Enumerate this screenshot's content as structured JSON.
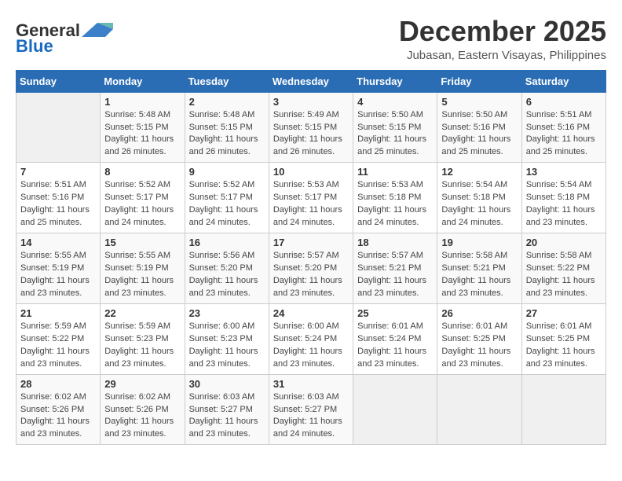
{
  "header": {
    "logo_general": "General",
    "logo_blue": "Blue",
    "month": "December 2025",
    "location": "Jubasan, Eastern Visayas, Philippines"
  },
  "days_of_week": [
    "Sunday",
    "Monday",
    "Tuesday",
    "Wednesday",
    "Thursday",
    "Friday",
    "Saturday"
  ],
  "weeks": [
    [
      {
        "day": "",
        "info": ""
      },
      {
        "day": "1",
        "info": "Sunrise: 5:48 AM\nSunset: 5:15 PM\nDaylight: 11 hours\nand 26 minutes."
      },
      {
        "day": "2",
        "info": "Sunrise: 5:48 AM\nSunset: 5:15 PM\nDaylight: 11 hours\nand 26 minutes."
      },
      {
        "day": "3",
        "info": "Sunrise: 5:49 AM\nSunset: 5:15 PM\nDaylight: 11 hours\nand 26 minutes."
      },
      {
        "day": "4",
        "info": "Sunrise: 5:50 AM\nSunset: 5:15 PM\nDaylight: 11 hours\nand 25 minutes."
      },
      {
        "day": "5",
        "info": "Sunrise: 5:50 AM\nSunset: 5:16 PM\nDaylight: 11 hours\nand 25 minutes."
      },
      {
        "day": "6",
        "info": "Sunrise: 5:51 AM\nSunset: 5:16 PM\nDaylight: 11 hours\nand 25 minutes."
      }
    ],
    [
      {
        "day": "7",
        "info": "Sunrise: 5:51 AM\nSunset: 5:16 PM\nDaylight: 11 hours\nand 25 minutes."
      },
      {
        "day": "8",
        "info": "Sunrise: 5:52 AM\nSunset: 5:17 PM\nDaylight: 11 hours\nand 24 minutes."
      },
      {
        "day": "9",
        "info": "Sunrise: 5:52 AM\nSunset: 5:17 PM\nDaylight: 11 hours\nand 24 minutes."
      },
      {
        "day": "10",
        "info": "Sunrise: 5:53 AM\nSunset: 5:17 PM\nDaylight: 11 hours\nand 24 minutes."
      },
      {
        "day": "11",
        "info": "Sunrise: 5:53 AM\nSunset: 5:18 PM\nDaylight: 11 hours\nand 24 minutes."
      },
      {
        "day": "12",
        "info": "Sunrise: 5:54 AM\nSunset: 5:18 PM\nDaylight: 11 hours\nand 24 minutes."
      },
      {
        "day": "13",
        "info": "Sunrise: 5:54 AM\nSunset: 5:18 PM\nDaylight: 11 hours\nand 23 minutes."
      }
    ],
    [
      {
        "day": "14",
        "info": "Sunrise: 5:55 AM\nSunset: 5:19 PM\nDaylight: 11 hours\nand 23 minutes."
      },
      {
        "day": "15",
        "info": "Sunrise: 5:55 AM\nSunset: 5:19 PM\nDaylight: 11 hours\nand 23 minutes."
      },
      {
        "day": "16",
        "info": "Sunrise: 5:56 AM\nSunset: 5:20 PM\nDaylight: 11 hours\nand 23 minutes."
      },
      {
        "day": "17",
        "info": "Sunrise: 5:57 AM\nSunset: 5:20 PM\nDaylight: 11 hours\nand 23 minutes."
      },
      {
        "day": "18",
        "info": "Sunrise: 5:57 AM\nSunset: 5:21 PM\nDaylight: 11 hours\nand 23 minutes."
      },
      {
        "day": "19",
        "info": "Sunrise: 5:58 AM\nSunset: 5:21 PM\nDaylight: 11 hours\nand 23 minutes."
      },
      {
        "day": "20",
        "info": "Sunrise: 5:58 AM\nSunset: 5:22 PM\nDaylight: 11 hours\nand 23 minutes."
      }
    ],
    [
      {
        "day": "21",
        "info": "Sunrise: 5:59 AM\nSunset: 5:22 PM\nDaylight: 11 hours\nand 23 minutes."
      },
      {
        "day": "22",
        "info": "Sunrise: 5:59 AM\nSunset: 5:23 PM\nDaylight: 11 hours\nand 23 minutes."
      },
      {
        "day": "23",
        "info": "Sunrise: 6:00 AM\nSunset: 5:23 PM\nDaylight: 11 hours\nand 23 minutes."
      },
      {
        "day": "24",
        "info": "Sunrise: 6:00 AM\nSunset: 5:24 PM\nDaylight: 11 hours\nand 23 minutes."
      },
      {
        "day": "25",
        "info": "Sunrise: 6:01 AM\nSunset: 5:24 PM\nDaylight: 11 hours\nand 23 minutes."
      },
      {
        "day": "26",
        "info": "Sunrise: 6:01 AM\nSunset: 5:25 PM\nDaylight: 11 hours\nand 23 minutes."
      },
      {
        "day": "27",
        "info": "Sunrise: 6:01 AM\nSunset: 5:25 PM\nDaylight: 11 hours\nand 23 minutes."
      }
    ],
    [
      {
        "day": "28",
        "info": "Sunrise: 6:02 AM\nSunset: 5:26 PM\nDaylight: 11 hours\nand 23 minutes."
      },
      {
        "day": "29",
        "info": "Sunrise: 6:02 AM\nSunset: 5:26 PM\nDaylight: 11 hours\nand 23 minutes."
      },
      {
        "day": "30",
        "info": "Sunrise: 6:03 AM\nSunset: 5:27 PM\nDaylight: 11 hours\nand 23 minutes."
      },
      {
        "day": "31",
        "info": "Sunrise: 6:03 AM\nSunset: 5:27 PM\nDaylight: 11 hours\nand 24 minutes."
      },
      {
        "day": "",
        "info": ""
      },
      {
        "day": "",
        "info": ""
      },
      {
        "day": "",
        "info": ""
      }
    ]
  ]
}
